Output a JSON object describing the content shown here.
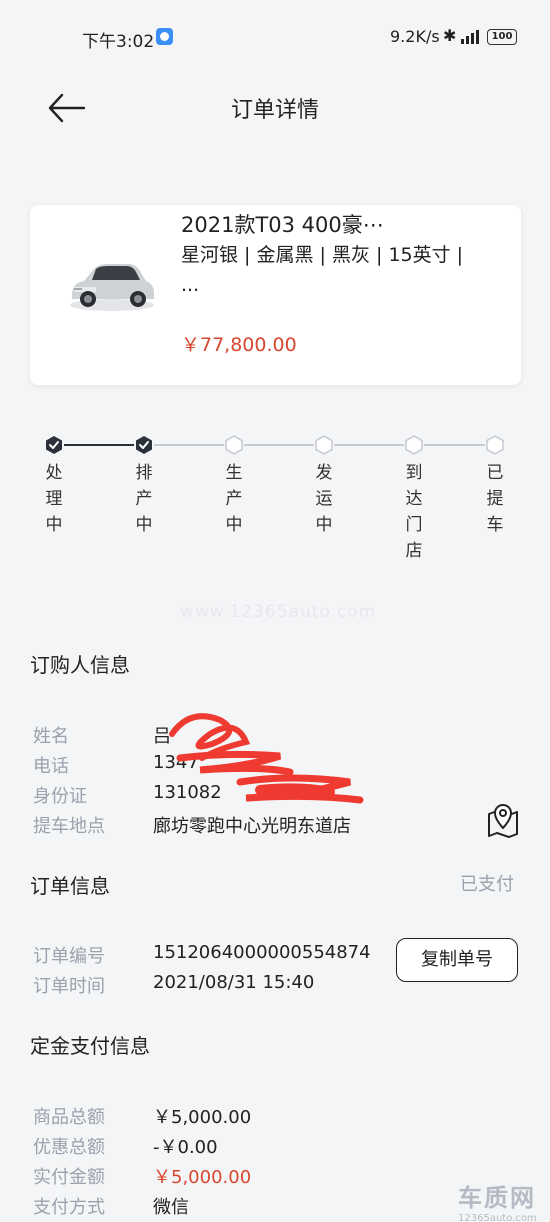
{
  "statusbar": {
    "time": "下午3:02",
    "network": "9.2K/s",
    "bluetooth_icon": "bluetooth-icon",
    "battery": "100"
  },
  "header": {
    "title": "订单详情",
    "back_icon": "arrow-left-icon"
  },
  "product": {
    "title": "2021款T03 400豪⋯",
    "spec": "星河银 | 金属黑 | 黑灰 | 15英寸 | ...",
    "price": "￥77,800.00",
    "image_icon": "car-icon"
  },
  "progress": {
    "steps": [
      {
        "label": "处理中",
        "done": true
      },
      {
        "label": "排产中",
        "done": true
      },
      {
        "label": "生产中",
        "done": false
      },
      {
        "label": "发运中",
        "done": false
      },
      {
        "label": "到达门店",
        "done": false
      },
      {
        "label": "已提车",
        "done": false
      }
    ],
    "colors": {
      "done": "#2a313b",
      "pending": "#c8ccd2"
    }
  },
  "watermark": "www.12365auto.com",
  "buyer": {
    "section_title": "订购人信息",
    "name_label": "姓名",
    "name_value": "吕",
    "phone_label": "电话",
    "phone_value": "1347",
    "id_label": "身份证",
    "id_value": "131082",
    "pickup_label": "提车地点",
    "pickup_value": "廊坊零跑中心光明东道店",
    "map_icon": "map-pin-icon"
  },
  "order": {
    "section_title": "订单信息",
    "status": "已支付",
    "number_label": "订单编号",
    "number_value": "1512064000000554874",
    "time_label": "订单时间",
    "time_value": "2021/08/31 15:40",
    "copy_button": "复制单号"
  },
  "payment": {
    "section_title": "定金支付信息",
    "total_label": "商品总额",
    "total_value": "￥5,000.00",
    "discount_label": "优惠总额",
    "discount_value": "-￥0.00",
    "paid_label": "实付金额",
    "paid_value": "￥5,000.00",
    "method_label": "支付方式",
    "method_value": "微信"
  },
  "site_logo": {
    "text": "车质网",
    "sub": "12365auto.com"
  },
  "colors": {
    "accent_red": "#d8472f",
    "muted": "#9aa2ad"
  }
}
